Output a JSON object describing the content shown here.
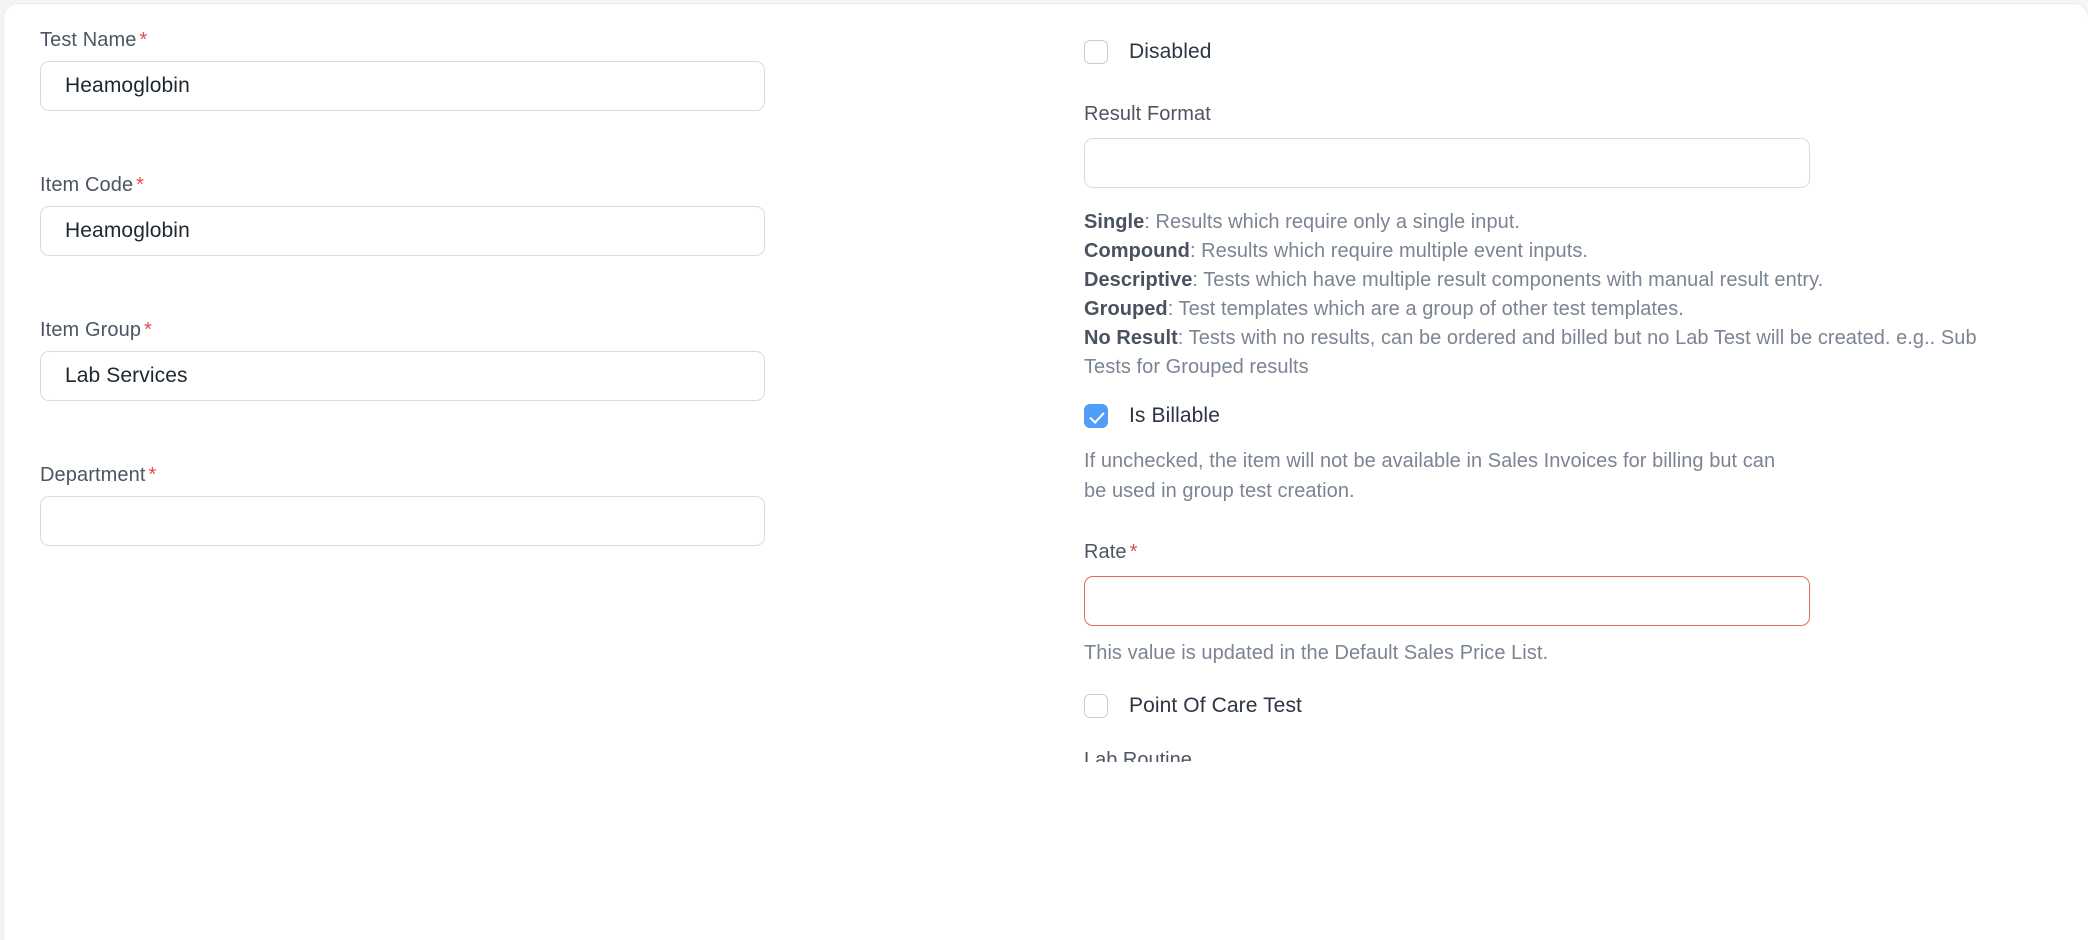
{
  "theme": {
    "accent_blue": "#4f9df7",
    "required_red": "#e24c4c",
    "error_border": "#e06c5e",
    "border_grey": "#d8dce2",
    "label_grey": "#4c5562",
    "muted_grey": "#7b8493",
    "value_dark": "#1f272e",
    "card_white": "#ffffff"
  },
  "left_column": {
    "fields": [
      {
        "label": "Test Name",
        "required": true,
        "required_mark": "*",
        "value": "Heamoglobin",
        "placeholder": "",
        "name": "test-name"
      },
      {
        "label": "Item Code",
        "required": true,
        "required_mark": "*",
        "value": "Heamoglobin",
        "placeholder": "",
        "name": "item-code"
      },
      {
        "label": "Item Group",
        "required": true,
        "required_mark": "*",
        "value": "Lab Services",
        "placeholder": "",
        "name": "item-group"
      },
      {
        "label": "Department",
        "required": true,
        "required_mark": "*",
        "value": "",
        "placeholder": "",
        "name": "department"
      }
    ]
  },
  "right_column": {
    "disabled_checkbox": {
      "label": "Disabled",
      "checked": false
    },
    "result_format": {
      "label": "Result Format",
      "required": false,
      "value": "",
      "placeholder": "",
      "icon": "select-chevrons-icon",
      "options": [
        "Single",
        "Compound",
        "Descriptive",
        "Grouped",
        "No Result"
      ],
      "descriptions": [
        {
          "term": "Single",
          "sep": ": ",
          "text": "Results which require only a single input."
        },
        {
          "term": "Compound",
          "sep": ": ",
          "text": "Results which require multiple event inputs."
        },
        {
          "term": "Descriptive",
          "sep": ": ",
          "text": "Tests which have multiple result components with manual result entry."
        },
        {
          "term": "Grouped",
          "sep": ": ",
          "text": "Test templates which are a group of other test templates."
        },
        {
          "term": "No Result",
          "sep": ": ",
          "text": "Tests with no results, can be ordered and billed but no Lab Test will be created. e.g.. Sub Tests for Grouped results"
        }
      ]
    },
    "is_billable": {
      "label": "Is Billable",
      "checked": true,
      "helper": "If unchecked, the item will not be available in Sales Invoices for billing but can be used in group test creation."
    },
    "rate": {
      "label": "Rate",
      "required": true,
      "required_mark": "*",
      "value": "",
      "placeholder": "",
      "error": true,
      "helper": "This value is updated in the Default Sales Price List."
    },
    "point_of_care_test": {
      "label": "Point Of Care Test",
      "checked": false
    },
    "clipped_label": "Lab Routine"
  }
}
